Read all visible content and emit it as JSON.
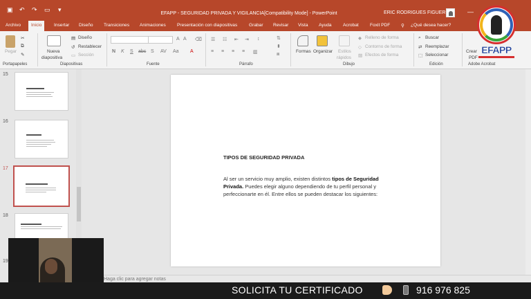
{
  "window": {
    "title": "EFAPP - SEGURIDAD PRIVADA Y VIGILANCIA[Compatibility Mode] - PowerPoint",
    "user": "ERIC RODRIGUES FIGUEROA",
    "minimize": "—",
    "restore": "❐",
    "close": "✕"
  },
  "quick_access": [
    "save-icon",
    "undo-icon",
    "redo-icon",
    "present-icon",
    "customize-icon"
  ],
  "tabs": [
    {
      "label": "Archivo"
    },
    {
      "label": "Inicio"
    },
    {
      "label": "Insertar"
    },
    {
      "label": "Diseño"
    },
    {
      "label": "Transiciones"
    },
    {
      "label": "Animaciones"
    },
    {
      "label": "Presentación con diapositivas"
    },
    {
      "label": "Grabar"
    },
    {
      "label": "Revisar"
    },
    {
      "label": "Vista"
    },
    {
      "label": "Ayuda"
    },
    {
      "label": "Acrobat"
    },
    {
      "label": "Foxit PDF"
    },
    {
      "label": "¿Qué desea hacer?"
    }
  ],
  "ribbon": {
    "paste": "Pegar",
    "clipboard_group": "Portapapeles",
    "new_slide": "Nueva",
    "new_slide_2": "diapositiva",
    "layout": "Diseño",
    "reset": "Restablecer",
    "section": "Sección",
    "slides_group": "Diapositivas",
    "font_group": "Fuente",
    "paragraph_group": "Párrafo",
    "shapes": "Formas",
    "arrange": "Organizar",
    "quick_styles": "Estilos",
    "quick_styles_2": "rápidos",
    "shape_fill": "Relleno de forma",
    "shape_outline": "Contorno de forma",
    "shape_effects": "Efectos de forma",
    "drawing_group": "Dibujo",
    "find": "Buscar",
    "replace": "Reemplazar",
    "select": "Seleccionar",
    "editing_group": "Edición",
    "create_pdf": "Crear",
    "create_pdf_2": "PDF",
    "acrobat_group": "Adobe Acrobat",
    "format_buttons": [
      "N",
      "K",
      "S",
      "abc",
      "S",
      "AV",
      "Aa",
      "A"
    ]
  },
  "slides_panel": {
    "items": [
      {
        "number": "15",
        "selected": false
      },
      {
        "number": "16",
        "selected": false
      },
      {
        "number": "17",
        "selected": true
      },
      {
        "number": "18",
        "selected": false
      },
      {
        "number": "19",
        "selected": false
      }
    ]
  },
  "slide": {
    "title": "TIPOS DE SEGURIDAD PRIVADA",
    "body_pre": "Al ser un servicio muy amplio, existen distintos ",
    "body_bold": "tipos de Seguridad Privada.",
    "body_post": " Puedes elegir alguno dependiendo de tu perfil personal y perfeccionarte en él. Entre ellos se pueden destacar los siguientes:"
  },
  "notes": {
    "placeholder": "Haga clic para agregar notas"
  },
  "banner": {
    "text": "SOLICITA TU CERTIFICADO",
    "phone": "916 976 825"
  },
  "logo": {
    "text": "EFAPP"
  },
  "colors": {
    "accent": "#b7472a",
    "selected_slide_border": "#c0504d",
    "banner_bg": "#1b1b1b"
  }
}
